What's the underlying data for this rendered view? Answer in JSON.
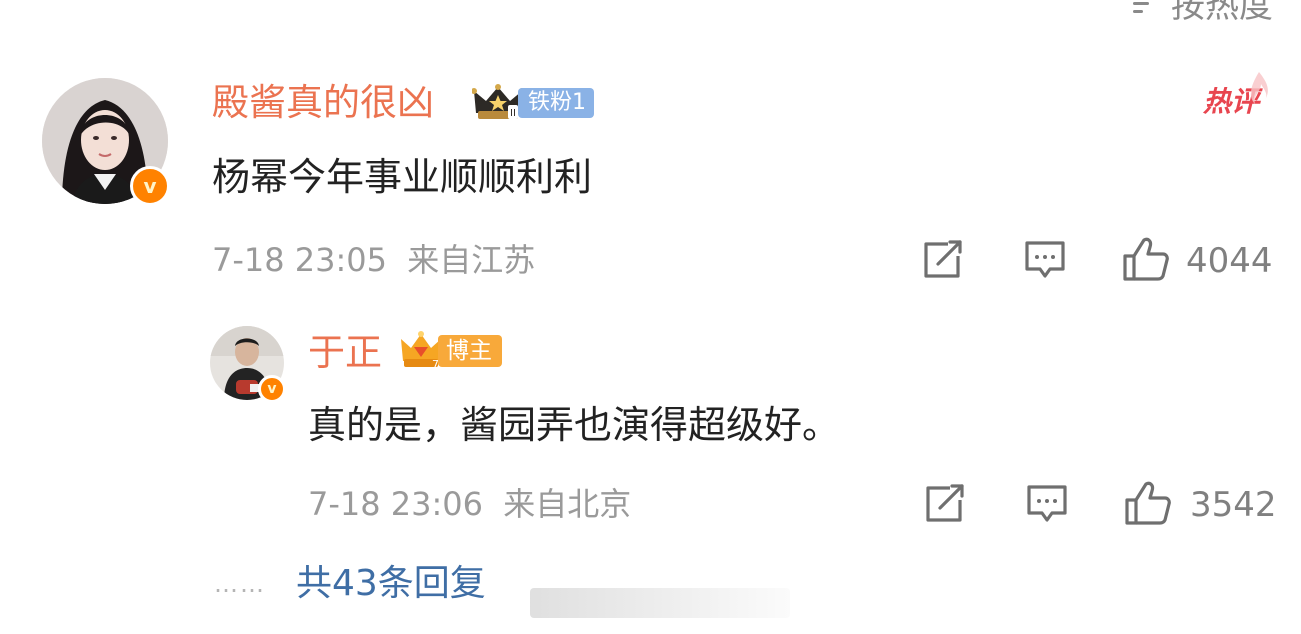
{
  "sort_label": "按热度",
  "colors": {
    "username": "#eb7350",
    "link": "#3f6ea5",
    "meta": "#9a9a9a",
    "hot": "#e8454f"
  },
  "main_comment": {
    "username": "殿酱真的很凶",
    "fan_badge": {
      "label": "铁粉1",
      "icon": "crown-icon"
    },
    "tag": "热评",
    "content": "杨幂今年事业顺顺利利",
    "time": "7-18 23:05",
    "location": "来自江苏",
    "likes": "4044",
    "verified_icon": "v-verified-icon"
  },
  "reply": {
    "username": "于正",
    "badge": {
      "label": "博主",
      "icon": "blogger-crown-icon"
    },
    "content": "真的是，酱园弄也演得超级好。",
    "time": "7-18 23:06",
    "location": "来自北京",
    "likes": "3542",
    "verified_icon": "v-verified-icon"
  },
  "more_replies": {
    "dots": "……",
    "label": "共43条回复"
  },
  "actions": [
    "share-icon",
    "comment-icon",
    "like-icon"
  ]
}
